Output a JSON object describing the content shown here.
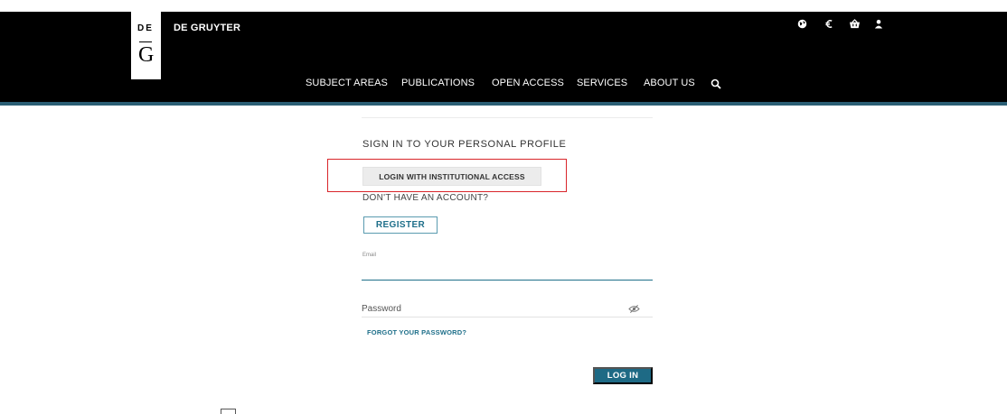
{
  "header": {
    "logo": {
      "top": "DE",
      "bottom": "G"
    },
    "brand": "DE GRUYTER",
    "icons": [
      "globe-icon",
      "euro-icon",
      "cart-icon",
      "user-icon"
    ],
    "nav": {
      "items": [
        "SUBJECT AREAS",
        "PUBLICATIONS",
        "OPEN ACCESS",
        "SERVICES",
        "ABOUT US"
      ],
      "search_icon": "search-icon"
    }
  },
  "form": {
    "title": "SIGN IN TO YOUR PERSONAL PROFILE",
    "institutional_button": "LOGIN WITH INSTITUTIONAL ACCESS",
    "no_account": "DON'T HAVE AN ACCOUNT?",
    "register_button": "REGISTER",
    "email_label": "Email",
    "email_value": "",
    "password_placeholder": "Password",
    "password_toggle_icon": "eye-slash-icon",
    "forgot_link": "FORGOT YOUR PASSWORD?",
    "login_button": "LOG IN"
  },
  "colors": {
    "header_bg": "#000000",
    "header_accent": "#2a5e74",
    "brand_teal": "#1e6a85",
    "highlight_red": "#d9252a"
  }
}
